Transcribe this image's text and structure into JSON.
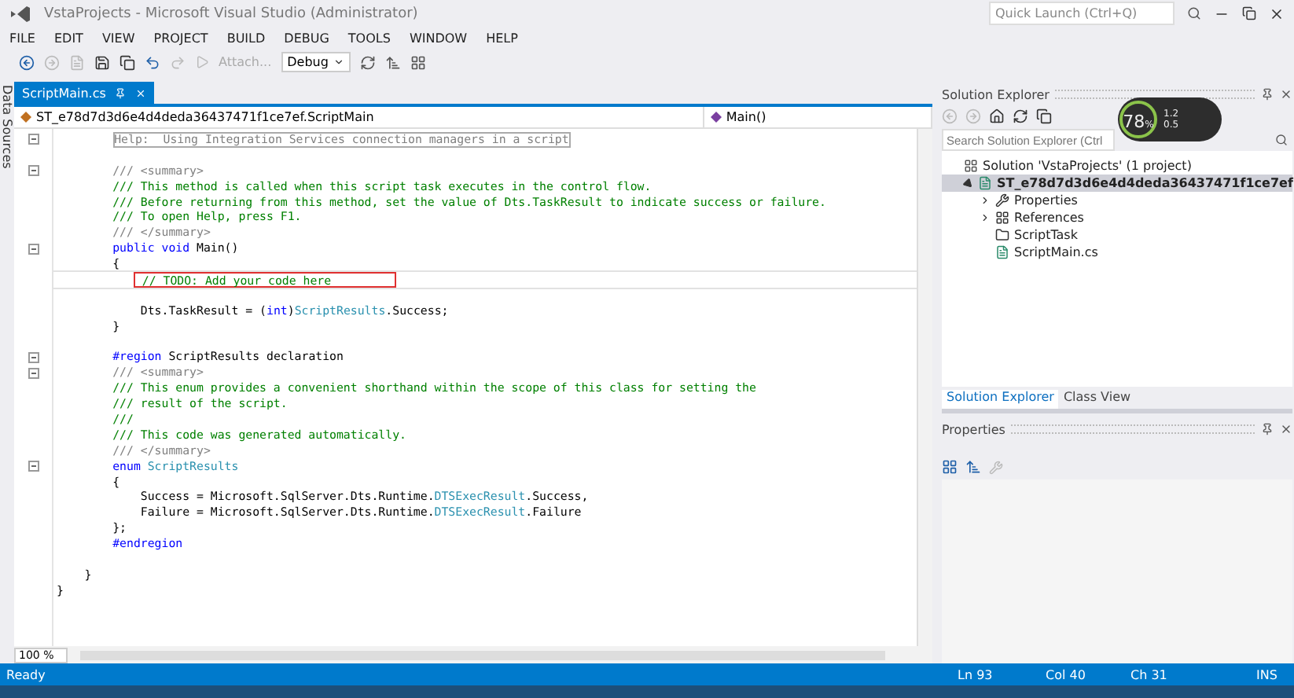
{
  "window": {
    "title": "VstaProjects - Microsoft Visual Studio (Administrator)",
    "quick_launch": {
      "placeholder": "Quick Launch (Ctrl+Q)"
    }
  },
  "menu": [
    "FILE",
    "EDIT",
    "VIEW",
    "PROJECT",
    "BUILD",
    "DEBUG",
    "TOOLS",
    "WINDOW",
    "HELP"
  ],
  "toolbar": {
    "attach": "Attach...",
    "configuration": "Debug"
  },
  "side_tab": "Data Sources",
  "document_tabs": [
    {
      "label": "ScriptMain.cs",
      "selected": true
    }
  ],
  "navigation": {
    "type": "ST_e78d7d3d6e4d4deda36437471f1ce7ef.ScriptMain",
    "member": "Main()"
  },
  "code_lines": [
    {
      "tokens": [
        {
          "kind": "collapsed",
          "text": "        Help:  Using Integration Services connection managers in a script"
        }
      ],
      "fold": true,
      "current": false,
      "marked": false
    },
    {
      "fold": false,
      "current": false,
      "marked": false
    },
    {
      "tokens": [
        {
          "kind": "doc",
          "text": "        /// <summary>"
        }
      ],
      "fold": true,
      "current": false,
      "marked": false
    },
    {
      "tokens": [
        {
          "kind": "comment",
          "text": "        /// This method is called when this script task executes in the control flow."
        }
      ],
      "fold": false,
      "current": false,
      "marked": false
    },
    {
      "tokens": [
        {
          "kind": "comment",
          "text": "        /// Before returning from this method, set the value of Dts.TaskResult to indicate success or failure."
        }
      ],
      "fold": false,
      "current": false,
      "marked": false
    },
    {
      "tokens": [
        {
          "kind": "comment",
          "text": "        /// To open Help, press F1."
        }
      ],
      "fold": false,
      "current": false,
      "marked": false
    },
    {
      "tokens": [
        {
          "kind": "doc",
          "text": "        /// </summary>"
        }
      ],
      "fold": false,
      "current": false,
      "marked": false
    },
    {
      "tokens": [
        {
          "kind": "keyword",
          "text": "        public void"
        },
        {
          "kind": "plain",
          "text": " Main()"
        }
      ],
      "fold": true,
      "current": false,
      "marked": false
    },
    {
      "tokens": [
        {
          "kind": "plain",
          "text": "        {"
        }
      ],
      "fold": false,
      "current": false,
      "marked": false
    },
    {
      "tokens": [
        {
          "kind": "comment",
          "text": "            // TODO: Add your code here"
        }
      ],
      "fold": false,
      "current": true,
      "marked": true
    },
    {
      "fold": false,
      "current": false,
      "marked": false
    },
    {
      "tokens": [
        {
          "kind": "plain",
          "text": "            Dts.TaskResult = ("
        },
        {
          "kind": "keyword",
          "text": "int"
        },
        {
          "kind": "plain",
          "text": ")"
        },
        {
          "kind": "type",
          "text": "ScriptResults"
        },
        {
          "kind": "plain",
          "text": ".Success;"
        }
      ],
      "fold": false,
      "current": false,
      "marked": false
    },
    {
      "tokens": [
        {
          "kind": "plain",
          "text": "        }"
        }
      ],
      "fold": false,
      "current": false,
      "marked": false
    },
    {
      "fold": false,
      "current": false,
      "marked": false
    },
    {
      "tokens": [
        {
          "kind": "keyword",
          "text": "        #region"
        },
        {
          "kind": "plain",
          "text": " ScriptResults declaration"
        }
      ],
      "fold": true,
      "current": false,
      "marked": false
    },
    {
      "tokens": [
        {
          "kind": "doc",
          "text": "        /// <summary>"
        }
      ],
      "fold": true,
      "current": false,
      "marked": false
    },
    {
      "tokens": [
        {
          "kind": "comment",
          "text": "        /// This enum provides a convenient shorthand within the scope of this class for setting the"
        }
      ],
      "fold": false,
      "current": false,
      "marked": false
    },
    {
      "tokens": [
        {
          "kind": "comment",
          "text": "        /// result of the script."
        }
      ],
      "fold": false,
      "current": false,
      "marked": false
    },
    {
      "tokens": [
        {
          "kind": "comment",
          "text": "        ///"
        }
      ],
      "fold": false,
      "current": false,
      "marked": false
    },
    {
      "tokens": [
        {
          "kind": "comment",
          "text": "        /// This code was generated automatically."
        }
      ],
      "fold": false,
      "current": false,
      "marked": false
    },
    {
      "tokens": [
        {
          "kind": "doc",
          "text": "        /// </summary>"
        }
      ],
      "fold": false,
      "current": false,
      "marked": false
    },
    {
      "tokens": [
        {
          "kind": "keyword",
          "text": "        enum"
        },
        {
          "kind": "type",
          "text": " ScriptResults"
        }
      ],
      "fold": true,
      "current": false,
      "marked": false
    },
    {
      "tokens": [
        {
          "kind": "plain",
          "text": "        {"
        }
      ],
      "fold": false,
      "current": false,
      "marked": false
    },
    {
      "tokens": [
        {
          "kind": "plain",
          "text": "            Success = Microsoft.SqlServer.Dts.Runtime."
        },
        {
          "kind": "type",
          "text": "DTSExecResult"
        },
        {
          "kind": "plain",
          "text": ".Success,"
        }
      ],
      "fold": false,
      "current": false,
      "marked": false
    },
    {
      "tokens": [
        {
          "kind": "plain",
          "text": "            Failure = Microsoft.SqlServer.Dts.Runtime."
        },
        {
          "kind": "type",
          "text": "DTSExecResult"
        },
        {
          "kind": "plain",
          "text": ".Failure"
        }
      ],
      "fold": false,
      "current": false,
      "marked": false
    },
    {
      "tokens": [
        {
          "kind": "plain",
          "text": "        };"
        }
      ],
      "fold": false,
      "current": false,
      "marked": false
    },
    {
      "tokens": [
        {
          "kind": "keyword",
          "text": "        #endregion"
        }
      ],
      "fold": false,
      "current": false,
      "marked": false
    },
    {
      "fold": false,
      "current": false,
      "marked": false
    },
    {
      "tokens": [
        {
          "kind": "plain",
          "text": "    }"
        }
      ],
      "fold": false,
      "current": false,
      "marked": false
    },
    {
      "tokens": [
        {
          "kind": "plain",
          "text": "}"
        }
      ],
      "fold": false,
      "current": false,
      "marked": false
    }
  ],
  "zoom_level": "100 %",
  "solution_explorer": {
    "title": "Solution Explorer",
    "search": {
      "placeholder": "Search Solution Explorer (Ctrl"
    },
    "tree": [
      {
        "label": "Solution 'VstaProjects' (1 project)",
        "kind": "solution",
        "selected": false,
        "children": [
          {
            "label": "ST_e78d7d3d6e4d4deda36437471f1ce7ef",
            "kind": "project",
            "selected": true,
            "expanded": true,
            "children": [
              {
                "label": "Properties",
                "kind": "properties",
                "selected": false,
                "expanded": false
              },
              {
                "label": "References",
                "kind": "references",
                "selected": false,
                "expanded": false
              },
              {
                "label": "ScriptTask",
                "kind": "folder",
                "selected": false
              },
              {
                "label": "ScriptMain.cs",
                "kind": "csharp",
                "selected": false
              }
            ]
          }
        ]
      }
    ]
  },
  "panel_tabs": [
    {
      "label": "Solution Explorer",
      "selected": true
    },
    {
      "label": "Class View",
      "selected": false
    }
  ],
  "properties": {
    "title": "Properties"
  },
  "net_meter": {
    "percent": "78",
    "unit": "%",
    "upload": "1.2",
    "download": "0.5"
  },
  "status_bar": {
    "state": "Ready",
    "line": "Ln 93",
    "column": "Col 40",
    "char": "Ch 31",
    "mode": "INS"
  }
}
